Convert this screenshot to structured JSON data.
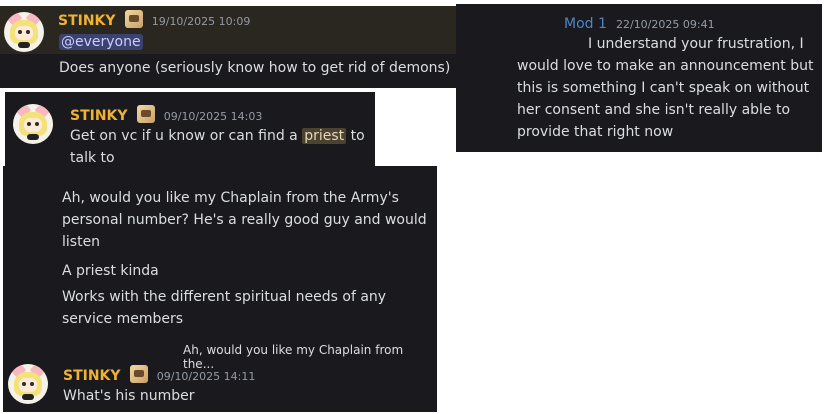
{
  "msg1": {
    "username": "STINKY",
    "timestamp": "19/10/2025 10:09",
    "mention": "@everyone",
    "text": "Does anyone (seriously know how to get rid of demons)"
  },
  "msg2": {
    "username": "Mod 1",
    "timestamp": "22/10/2025 09:41",
    "lines": [
      "I understand your frustration, I",
      "would love to make an announcement but",
      "this is something I can't speak on without",
      "her consent and she isn't really able to",
      "provide that right now"
    ]
  },
  "msg3": {
    "username": "STINKY",
    "timestamp": "09/10/2025 14:03",
    "text_before": "Get on vc if u know or can find a ",
    "highlight": "priest",
    "text_after": " to",
    "line2": "talk to"
  },
  "msg4": {
    "line1": "Ah, would you like my Chaplain from the Army's",
    "line2": "personal number? He's a really good guy and would",
    "line3": "listen",
    "line4": "A priest kinda",
    "line5": "Works with the different spiritual needs of any",
    "line6": "service members"
  },
  "msg5": {
    "reply_preview": "Ah, would you like my Chaplain from the...",
    "username": "STINKY",
    "timestamp": "09/10/2025 14:11",
    "text": "What's his number"
  },
  "colors": {
    "panel_bg": "#1a1a1e",
    "username": "#f0b232",
    "mod_name": "#4c86c6",
    "mention_bg": "#3c4270"
  }
}
